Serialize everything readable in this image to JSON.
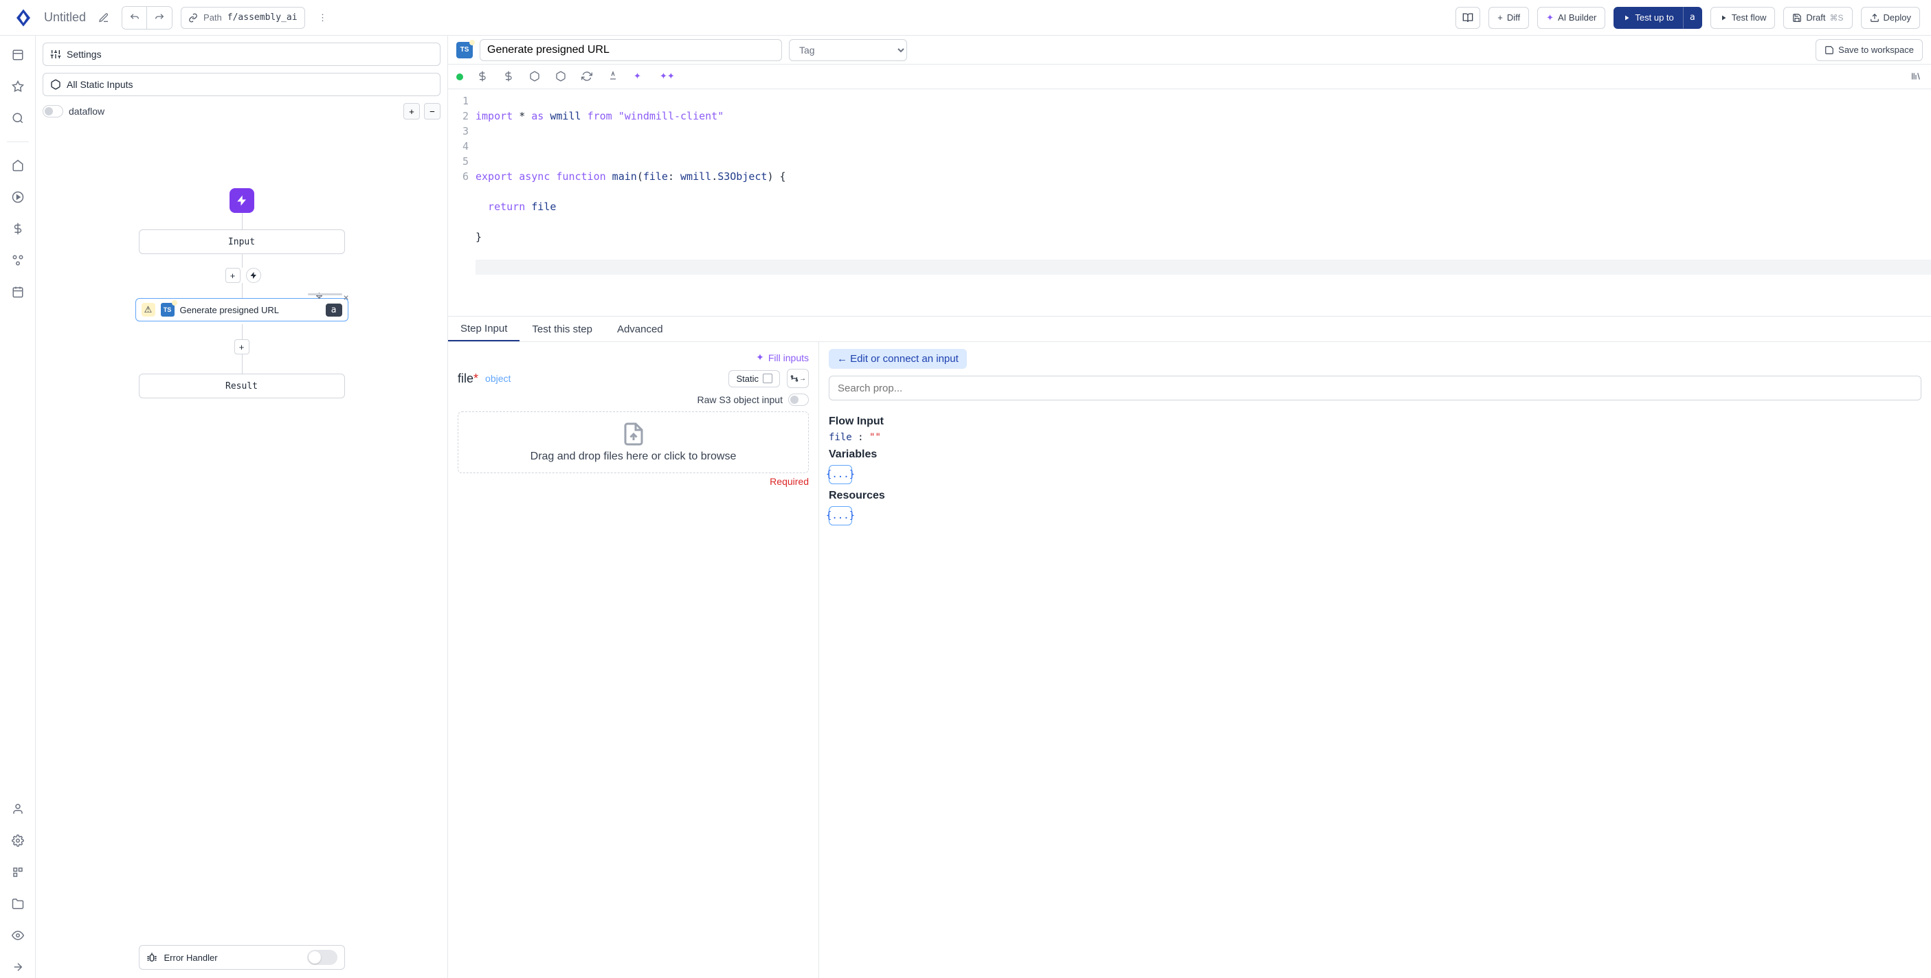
{
  "topbar": {
    "title": "Untitled",
    "path_label": "Path",
    "path_value": "f/assembly_ai",
    "diff": "Diff",
    "ai_builder": "AI Builder",
    "test_up_to": "Test up to",
    "test_up_to_badge": "a",
    "test_flow": "Test flow",
    "draft": "Draft",
    "draft_kbd": "⌘S",
    "deploy": "Deploy"
  },
  "midcol": {
    "settings": "Settings",
    "all_static": "All Static Inputs",
    "dataflow": "dataflow",
    "input_node": "Input",
    "action_label": "Generate presigned URL",
    "action_badge": "a",
    "result_node": "Result",
    "error_handler": "Error Handler"
  },
  "step": {
    "ts_badge": "TS",
    "title": "Generate presigned URL",
    "tag_placeholder": "Tag",
    "save_ws": "Save to workspace"
  },
  "code": {
    "lines": [
      "1",
      "2",
      "3",
      "4",
      "5",
      "6"
    ],
    "l1_import": "import",
    "l1_star": " * ",
    "l1_as": "as",
    "l1_wmill": " wmill ",
    "l1_from": "from",
    "l1_str": " \"windmill-client\"",
    "l3_export": "export",
    "l3_async": " async ",
    "l3_function": "function",
    "l3_main": " main",
    "l3_paren": "(",
    "l3_file": "file",
    "l3_colon": ": ",
    "l3_wmill2": "wmill",
    "l3_dot": ".",
    "l3_s3": "S3Object",
    "l3_close": ") {",
    "l4_return": "  return",
    "l4_file": " file",
    "l5_brace": "}"
  },
  "tabs": {
    "step_input": "Step Input",
    "test_this": "Test this step",
    "advanced": "Advanced"
  },
  "input_panel": {
    "fill_inputs": "Fill inputs",
    "file_label": "file",
    "object": "object",
    "static": "Static",
    "raw_label": "Raw S3 object input",
    "drop_text": "Drag and drop files here or click to browse",
    "required": "Required"
  },
  "connect_panel": {
    "edit_connect": "← Edit or connect an input",
    "search_placeholder": "Search prop...",
    "flow_input": "Flow Input",
    "file_key": "file",
    "file_val": "\"\"",
    "variables": "Variables",
    "resources": "Resources",
    "braces": "{...}"
  }
}
